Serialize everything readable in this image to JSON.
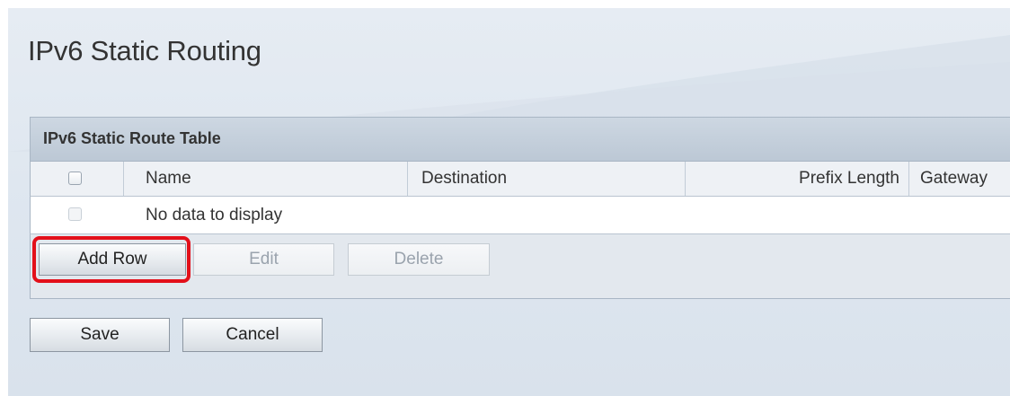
{
  "page": {
    "title": "IPv6 Static Routing"
  },
  "table": {
    "title": "IPv6 Static Route Table",
    "columns": [
      "Name",
      "Destination",
      "Prefix Length",
      "Gateway"
    ],
    "empty_message": "No data to display"
  },
  "table_actions": {
    "add_row_label": "Add Row",
    "edit_label": "Edit",
    "delete_label": "Delete"
  },
  "form_actions": {
    "save_label": "Save",
    "cancel_label": "Cancel"
  },
  "colors": {
    "highlight": "#e3101a",
    "header_background": "#c5d0dc",
    "page_background": "#dfe7f0"
  }
}
